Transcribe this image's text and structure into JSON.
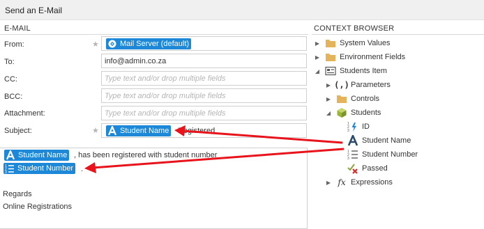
{
  "window": {
    "title": "Send an E-Mail"
  },
  "email": {
    "header": "E-MAIL",
    "from_label": "From:",
    "from_token": "Mail Server (default)",
    "to_label": "To:",
    "to_value": "info@admin.co.za",
    "cc_label": "CC:",
    "cc_placeholder": "Type text and/or drop multiple fields",
    "bcc_label": "BCC:",
    "bcc_placeholder": "Type text and/or drop multiple fields",
    "attachment_label": "Attachment:",
    "attachment_placeholder": "Type text and/or drop multiple fields",
    "subject_label": "Subject:",
    "subject_token": "Student Name",
    "subject_after": "Registered",
    "body": {
      "token_name": "Student Name",
      "line1_after": ", has been registered with student number",
      "token_number": "Student Number",
      "line2_after": ".",
      "regards": "Regards",
      "signature": "Online Registrations"
    }
  },
  "context": {
    "header": "CONTEXT BROWSER",
    "items": [
      {
        "label": "System Values",
        "icon": "folder-icon"
      },
      {
        "label": "Environment Fields",
        "icon": "folder-icon"
      },
      {
        "label": "Students Item",
        "icon": "form-icon"
      },
      {
        "label": "Parameters",
        "icon": "parameters-icon"
      },
      {
        "label": "Controls",
        "icon": "folder-icon"
      },
      {
        "label": "Students",
        "icon": "cube-icon"
      },
      {
        "label": "ID",
        "icon": "number-lightning-icon"
      },
      {
        "label": "Student Name",
        "icon": "text-a-icon"
      },
      {
        "label": "Student Number",
        "icon": "number-list-icon"
      },
      {
        "label": "Passed",
        "icon": "check-cross-icon"
      },
      {
        "label": "Expressions",
        "icon": "fx-icon"
      }
    ]
  },
  "colors": {
    "token": "#1e88d8",
    "arrow": "#e8131b",
    "folder": "#e5b35a",
    "cube": "#9ab33b"
  }
}
